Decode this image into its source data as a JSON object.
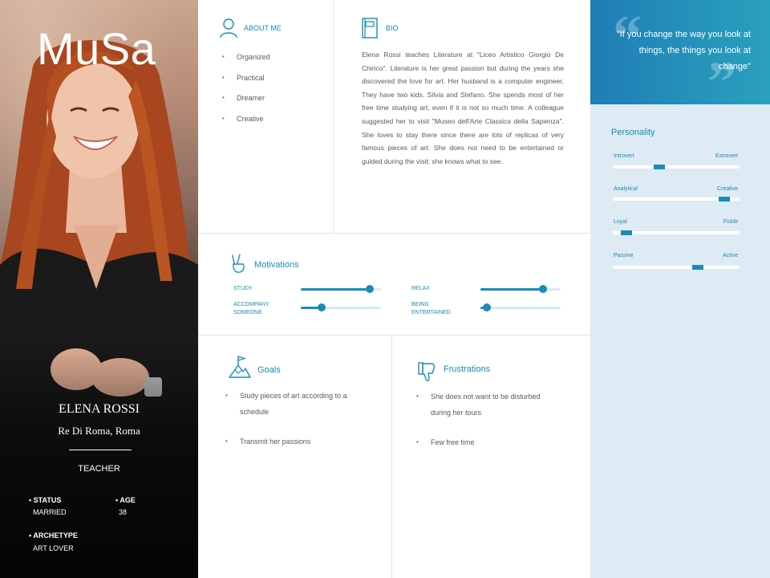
{
  "profile": {
    "persona_name": "MuSa",
    "full_name": "ELENA ROSSI",
    "location": "Re Di Roma, Roma",
    "role": "TEACHER",
    "status_label": "• STATUS",
    "status_value": "MARRIED",
    "age_label": "• AGE",
    "age_value": "38",
    "archetype_label": "• ARCHETYPE",
    "archetype_value": "ART LOVER"
  },
  "about": {
    "title": "ABOUT ME",
    "icon": "person-icon",
    "items": [
      "Organized",
      "Practical",
      "Dreamer",
      "Creative"
    ]
  },
  "bio": {
    "title": "BIO",
    "icon": "notebook-icon",
    "text": "Elena Rossi teaches Literature at \"Liceo Artistico Giorgio De Chirico\". Literature is her great passion but during the years she discovered the love for art. Her husband is a computer engineer. They have two kids, Silvia and Stefano. She spends most of her free time studying art, even if it is not so much time. A colleague suggested her to visit \"Museo dell'Arte Classica della Sapienza\". She loves to stay there since there are lots of replicas of very famous pieces of art. She does not need to be entertained or guided during the visit: she knows what to see."
  },
  "motivations": {
    "title": "Motivations",
    "icon": "peace-hand-icon",
    "items": [
      {
        "line1": "STUDY",
        "line2": "",
        "value": 0.86
      },
      {
        "line1": "RELAX",
        "line2": "",
        "value": 0.78
      },
      {
        "line1": "ACCOMPANY",
        "line2": "SOMEONE",
        "value": 0.26
      },
      {
        "line1": "BEING",
        "line2": "ENTERTAINED",
        "value": 0.08
      }
    ]
  },
  "goals": {
    "title": "Goals",
    "icon": "mountain-flag-icon",
    "items": [
      {
        "line1": "Study pieces of art according to a",
        "line2": "schedule"
      },
      {
        "line1": "Transmit her passions",
        "line2": ""
      }
    ]
  },
  "frustrations": {
    "title": "Frustrations",
    "icon": "thumbs-down-icon",
    "items": [
      {
        "line1": "She does not want to be disturbed",
        "line2": "during her tours"
      },
      {
        "line1": "Few free time",
        "line2": ""
      }
    ]
  },
  "quote": {
    "text": "\"If you change the way you look at things, the things you look at change\""
  },
  "personality": {
    "title": "Personality",
    "traits": [
      {
        "left": "Introvert",
        "right": "Extrovert",
        "value": 0.37
      },
      {
        "left": "Analytical",
        "right": "Creative",
        "value": 0.88
      },
      {
        "left": "Loyal",
        "right": "Fickle",
        "value": 0.11
      },
      {
        "left": "Passive",
        "right": "Active",
        "value": 0.67
      }
    ]
  },
  "colors": {
    "accent": "#1b8bb4",
    "track": "#d3ebf6",
    "personality_bg": "#deeaf4",
    "quote_gradient_start": "#1f7db6",
    "quote_gradient_end": "#2aa1bd"
  }
}
